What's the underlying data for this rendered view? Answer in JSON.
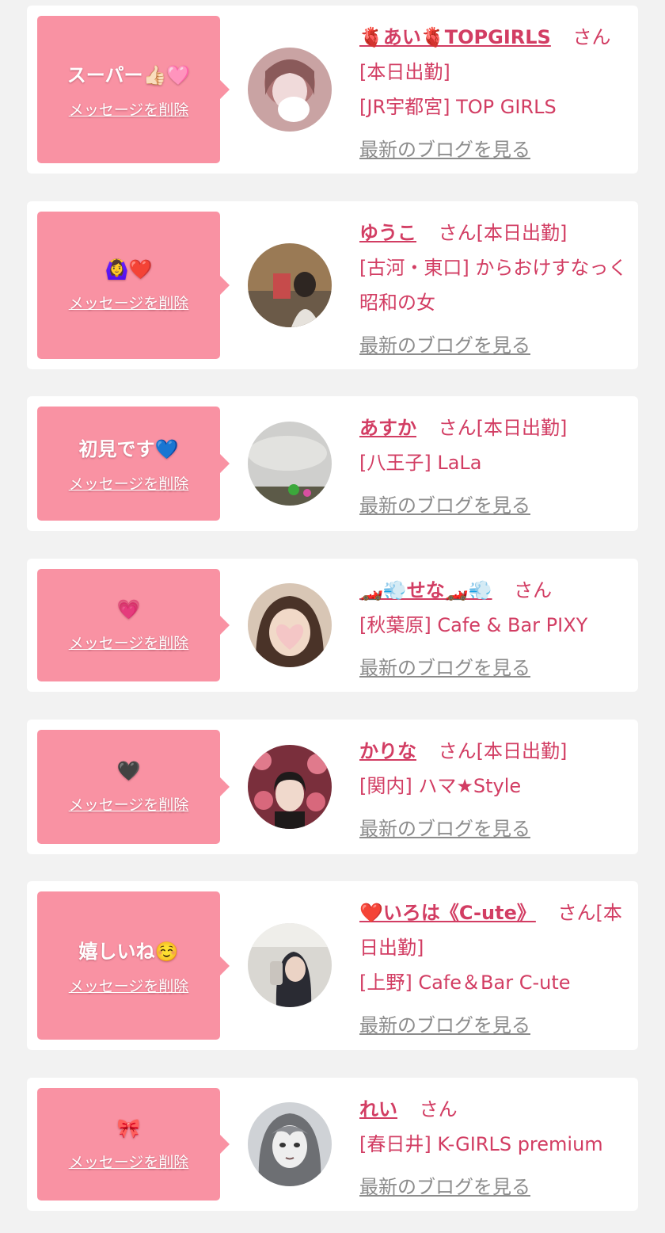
{
  "delete_label": "メッセージを削除",
  "blog_label": "最新のブログを見る",
  "colors": {
    "bubble": "#f992a3",
    "accent": "#d23d63",
    "link_gray": "#8c8c8c",
    "background": "#f2f2f2"
  },
  "items": [
    {
      "message": "スーパー👍🏻🩷",
      "name": "🫀あい🫀TOPGIRLS",
      "suffix": "さん",
      "status": "[本日出勤]",
      "shop": "[JR宇都宮] TOP GIRLS"
    },
    {
      "message": "🙆‍♀️❤️",
      "name": "ゆうこ",
      "suffix": "さん",
      "status": "[本日出勤]",
      "shop": "[古河・東口] からおけすなっく 昭和の女"
    },
    {
      "message": "初見です💙",
      "name": "あすか",
      "suffix": "さん",
      "status": "[本日出勤]",
      "shop": "[八王子] LaLa"
    },
    {
      "message": "💗",
      "name": "🏎️💨せな🏎️💨",
      "suffix": "さん",
      "status": "",
      "shop": "[秋葉原] Cafe & Bar PIXY"
    },
    {
      "message": "🖤",
      "name": "かりな",
      "suffix": "さん",
      "status": "[本日出勤]",
      "shop": "[関内] ハマ★Style"
    },
    {
      "message": "嬉しいね☺️",
      "name": "❤️いろは《C-ute》",
      "suffix": "さん",
      "status": "[本日出勤]",
      "shop": "[上野] Cafe＆Bar C-ute"
    },
    {
      "message": "🎀",
      "name": "れい",
      "suffix": "さん",
      "status": "",
      "shop": "[春日井] K-GIRLS premium"
    }
  ]
}
